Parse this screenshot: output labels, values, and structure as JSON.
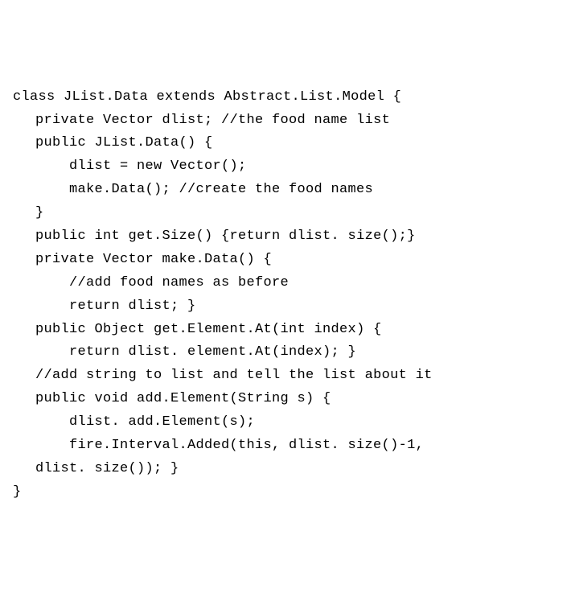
{
  "code": {
    "l1": "class JList.Data extends Abstract.List.Model {",
    "l2": "private Vector dlist; //the food name list",
    "l3": "public JList.Data() {",
    "l4": "dlist = new Vector();",
    "l5": "make.Data(); //create the food names",
    "l6": "}",
    "l7": "public int get.Size() {return dlist. size();}",
    "l8": "private Vector make.Data() {",
    "l9": "//add food names as before",
    "l10": "return dlist; }",
    "l11": "public Object get.Element.At(int index) {",
    "l12": "return dlist. element.At(index); }",
    "l13": "//add string to list and tell the list about it",
    "l14": "public void add.Element(String s) {",
    "l15": "dlist. add.Element(s);",
    "l16": "fire.Interval.Added(this, dlist. size()-1,",
    "l17": "dlist. size()); }",
    "l18": "}"
  }
}
